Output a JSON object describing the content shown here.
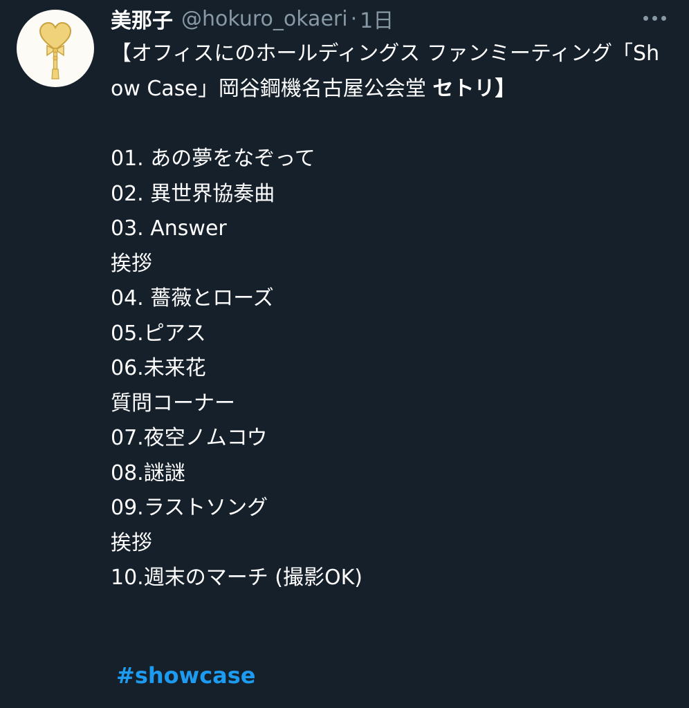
{
  "tweet": {
    "display_name": "美那子",
    "handle": "@hokuro_okaeri",
    "separator": "·",
    "time": "1日",
    "title_prefix": "【オフィスにのホールディングス ファンミーティング「Show Case」岡谷鋼機名古屋公会堂 ",
    "title_bold": "セトリ",
    "title_suffix": "】",
    "setlist": [
      "01. あの夢をなぞって",
      "02. 異世界協奏曲",
      "03. Answer",
      "挨拶",
      "04. 薔薇とローズ",
      "05.ピアス",
      "06.未来花",
      "質問コーナー",
      "07.夜空ノムコウ",
      "08.謎謎",
      "09.ラストソング",
      "挨拶",
      "10.週末のマーチ (撮影OK)"
    ],
    "hashtag": "#showcase"
  },
  "icons": {
    "avatar": "heart-wand-avatar",
    "more": "more-icon"
  },
  "colors": {
    "background": "#15202b",
    "text": "#ffffff",
    "secondary": "#8899a6",
    "link": "#1d9bf0",
    "avatar_bg": "#fcfbf6",
    "avatar_gold": "#e8c15a"
  }
}
